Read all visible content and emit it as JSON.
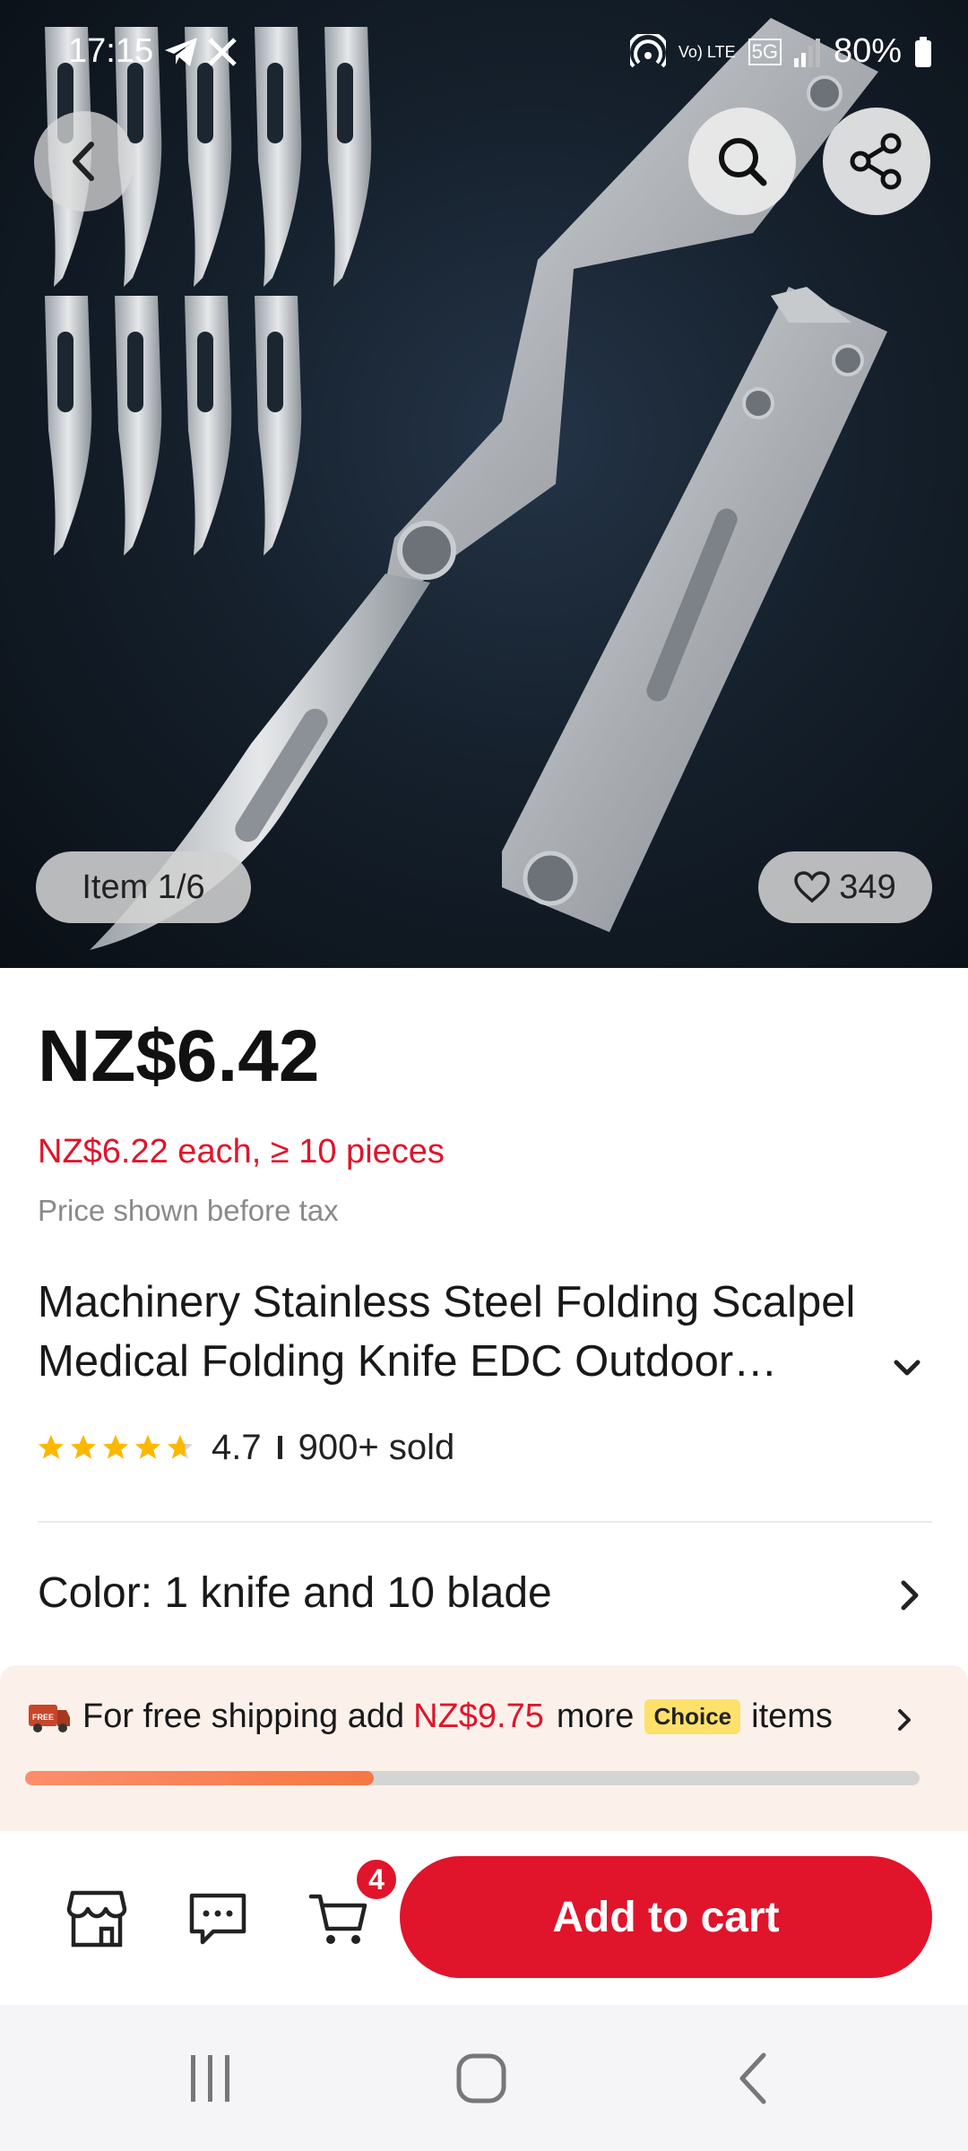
{
  "status_bar": {
    "time": "17:15",
    "network": "Vo) LTE",
    "signal_type": "5G",
    "battery": "80%"
  },
  "gallery": {
    "item_counter": "Item 1/6",
    "likes": "349",
    "icons": {
      "back": "chevron-left-icon",
      "search": "search-icon",
      "share": "share-icon",
      "like": "heart-icon"
    }
  },
  "product": {
    "price": "NZ$6.42",
    "bulk_price": "NZ$6.22 each, ≥ 10 pieces",
    "tax_note": "Price shown before tax",
    "title": "Machinery Stainless Steel Folding Scalpel Medical Folding Knife EDC Outdoor Unpacking Portable Utility Knife",
    "rating": "4.7",
    "rating_stars_fraction": 0.94,
    "sold": "900+ sold"
  },
  "variant": {
    "label": "Color: 1 knife and 10 blade"
  },
  "shipping": {
    "badge_text": "FREE",
    "prefix": "For free shipping add",
    "amount": "NZ$9.75",
    "more": "more",
    "choice": "Choice",
    "suffix": "items",
    "progress_fraction": 0.39
  },
  "actions": {
    "cart_count": "4",
    "add_to_cart": "Add to cart",
    "icons": {
      "store": "store-icon",
      "chat": "chat-icon",
      "cart": "cart-icon"
    }
  },
  "colors": {
    "accent_red": "#e0142b",
    "progress_orange": "#f77745",
    "choice_yellow": "#fde16b",
    "banner_bg": "#fcf1ea",
    "star_gold": "#fcb700"
  }
}
